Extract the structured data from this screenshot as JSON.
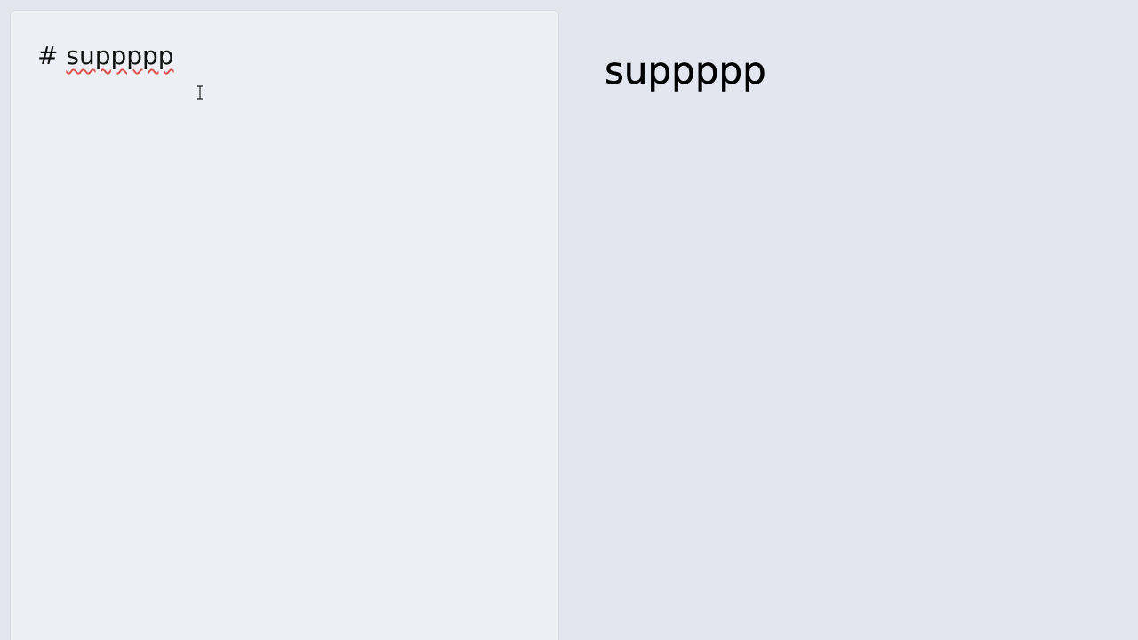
{
  "editor": {
    "hash": "#",
    "heading_text": "suppppp"
  },
  "preview": {
    "heading": "suppppp"
  }
}
